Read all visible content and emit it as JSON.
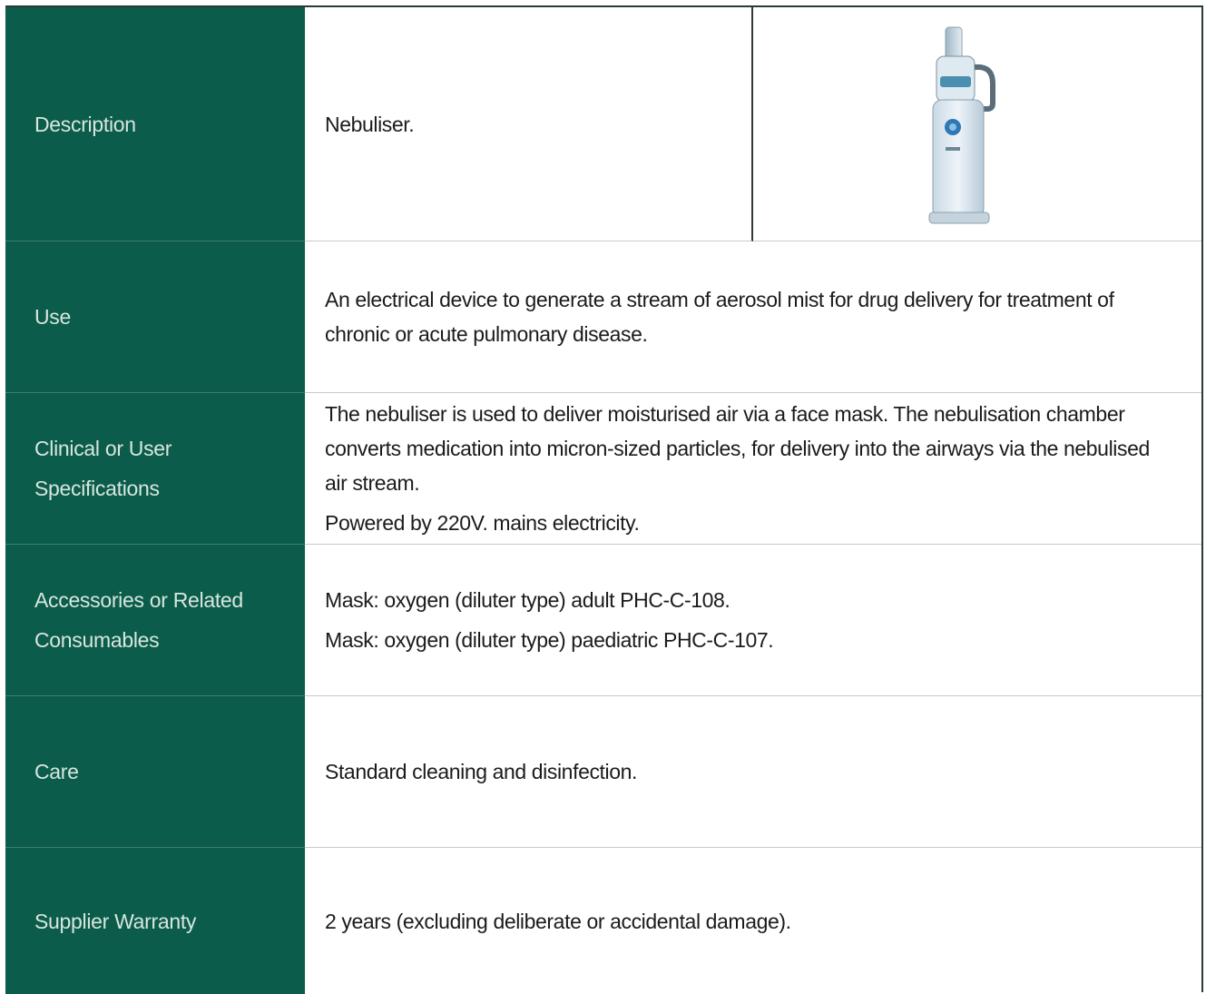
{
  "rows": [
    {
      "label": "Description",
      "value": [
        "Nebuliser."
      ]
    },
    {
      "label": "Use",
      "value": [
        "An electrical device to generate a stream of aerosol mist for drug delivery for treatment of chronic or acute pulmonary disease."
      ]
    },
    {
      "label": "Clinical or User Specifications",
      "value": [
        "The nebuliser is used to deliver moisturised air via a face mask. The nebulisation chamber converts medication into micron-sized particles, for delivery into the airways via the nebulised air stream.",
        "Powered by 220V. mains electricity."
      ]
    },
    {
      "label": "Accessories or Related Consumables",
      "value": [
        "Mask: oxygen (diluter type) adult PHC-C-108.",
        "Mask: oxygen (diluter type) paediatric PHC-C-107."
      ]
    },
    {
      "label": "Care",
      "value": [
        "Standard cleaning and disinfection."
      ]
    },
    {
      "label": "Supplier Warranty",
      "value": [
        "2 years (excluding deliberate or accidental damage)."
      ]
    }
  ],
  "image": {
    "icon": "nebuliser-device-photo"
  },
  "colors": {
    "label_bg": "#0b5c4a",
    "label_text": "#d7e6df",
    "body_text": "#1b1b1b",
    "rule": "#c9c9c9"
  }
}
